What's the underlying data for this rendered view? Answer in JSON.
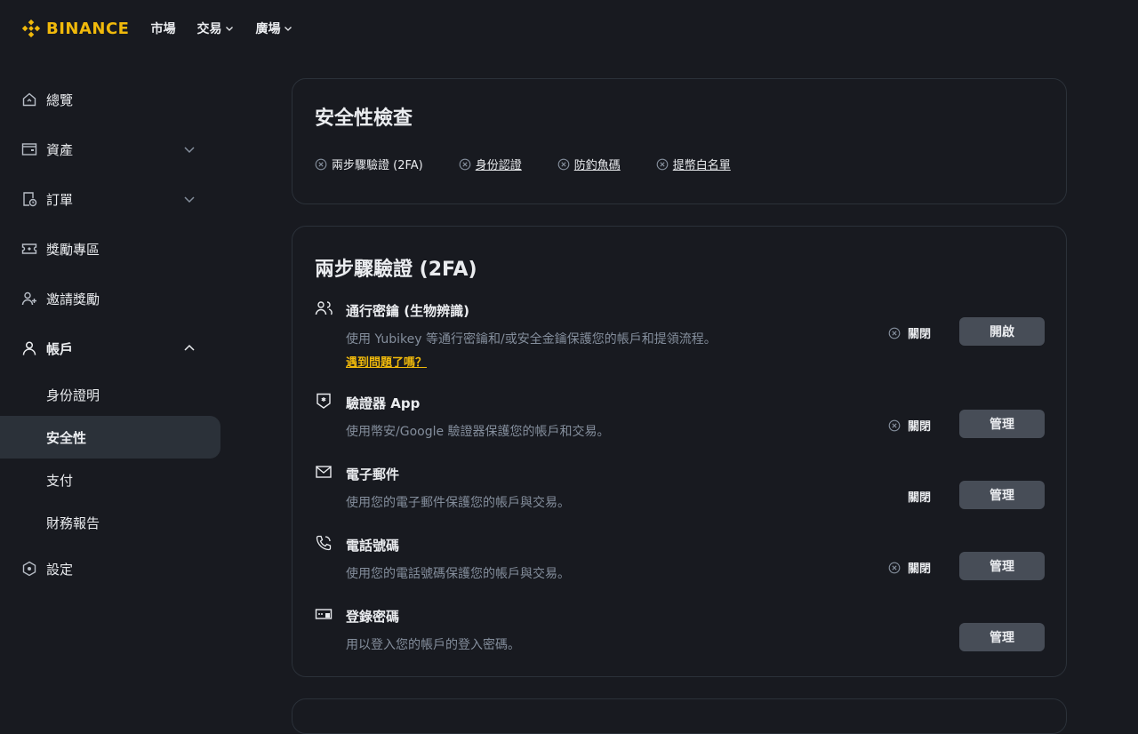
{
  "header": {
    "logo_text": "BINANCE",
    "nav": [
      {
        "label": "市場",
        "dropdown": false
      },
      {
        "label": "交易",
        "dropdown": true
      },
      {
        "label": "廣場",
        "dropdown": true
      }
    ]
  },
  "sidebar": {
    "items": [
      {
        "label": "總覽",
        "icon": "home-icon"
      },
      {
        "label": "資產",
        "icon": "wallet-icon"
      },
      {
        "label": "訂單",
        "icon": "orders-icon"
      },
      {
        "label": "獎勵專區",
        "icon": "ticket-icon"
      },
      {
        "label": "邀請獎勵",
        "icon": "add-user-icon"
      },
      {
        "label": "帳戶",
        "icon": "user-icon"
      },
      {
        "label": "設定",
        "icon": "settings-icon"
      }
    ],
    "account_sub": [
      "身份證明",
      "安全性",
      "支付",
      "財務報告"
    ],
    "active_sub": "安全性"
  },
  "security_check": {
    "title": "安全性檢查",
    "items": [
      "兩步驟驗證 (2FA)",
      "身份認證",
      "防釣魚碼",
      "提幣白名單"
    ]
  },
  "twofa": {
    "title": "兩步驟驗證 (2FA)",
    "rows": [
      {
        "title": "通行密鑰 (生物辨識)",
        "desc": "使用 Yubikey 等通行密鑰和/或安全金鑰保護您的帳戶和提領流程。",
        "link": "遇到問題了嗎？",
        "status": "關閉",
        "button": "開啟",
        "icon": "passkey-icon"
      },
      {
        "title": "驗證器 App",
        "desc": "使用幣安/Google 驗證器保護您的帳戶和交易。",
        "status": "關閉",
        "button": "管理",
        "icon": "authenticator-icon"
      },
      {
        "title": "電子郵件",
        "desc": "使用您的電子郵件保護您的帳戶與交易。",
        "status": "關閉",
        "button": "管理",
        "icon": "email-icon"
      },
      {
        "title": "電話號碼",
        "desc": "使用您的電話號碼保護您的帳戶與交易。",
        "status": "關閉",
        "button": "管理",
        "icon": "phone-icon"
      },
      {
        "title": "登錄密碼",
        "desc": "用以登入您的帳戶的登入密碼。",
        "button": "管理",
        "icon": "password-icon"
      }
    ]
  },
  "colors": {
    "background": "#181a20",
    "brand": "#f0b90b",
    "button": "#474d57",
    "muted_text": "#848e9c"
  }
}
